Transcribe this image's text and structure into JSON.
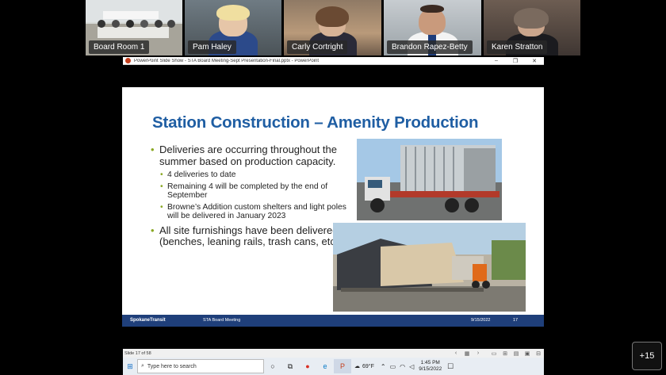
{
  "participants": [
    {
      "name": "Board Room 1"
    },
    {
      "name": "Pam Haley"
    },
    {
      "name": "Carly Cortright"
    },
    {
      "name": "Brandon Rapez-Betty"
    },
    {
      "name": "Karen Stratton"
    }
  ],
  "window": {
    "title": "PowerPoint Slide Show  -  STA Board Meeting-Sept Presentation-Final.pptx  -  PowerPoint",
    "icon": "powerpoint-icon",
    "controls": [
      "minimize",
      "restore",
      "close"
    ]
  },
  "slide": {
    "title": "Station Construction – Amenity Production",
    "bullets": [
      {
        "text": "Deliveries are occurring throughout the summer based on production capacity.",
        "sub": [
          "4 deliveries to date",
          "Remaining 4 will be completed by the end of September",
          "Browne’s Addition custom shelters and light poles will be delivered in January 2023"
        ]
      },
      {
        "text": "All site furnishings have been delivered (benches, leaning rails, trash cans, etc.)",
        "sub": []
      }
    ],
    "footer": {
      "brand": "SpokaneTransit",
      "meeting": "STA Board Meeting",
      "date": "9/15/2022",
      "page": "17"
    }
  },
  "statusbar": {
    "slide_count": "Slide 17 of 58"
  },
  "taskbar": {
    "search_placeholder": "Type here to search",
    "weather": "69°F",
    "time": "1:45 PM",
    "date": "9/15/2022"
  },
  "more_participants": "+15",
  "colors": {
    "title_blue": "#1f5ea3",
    "bullet_green": "#8aa823",
    "footer_navy": "#1f3f7a"
  }
}
